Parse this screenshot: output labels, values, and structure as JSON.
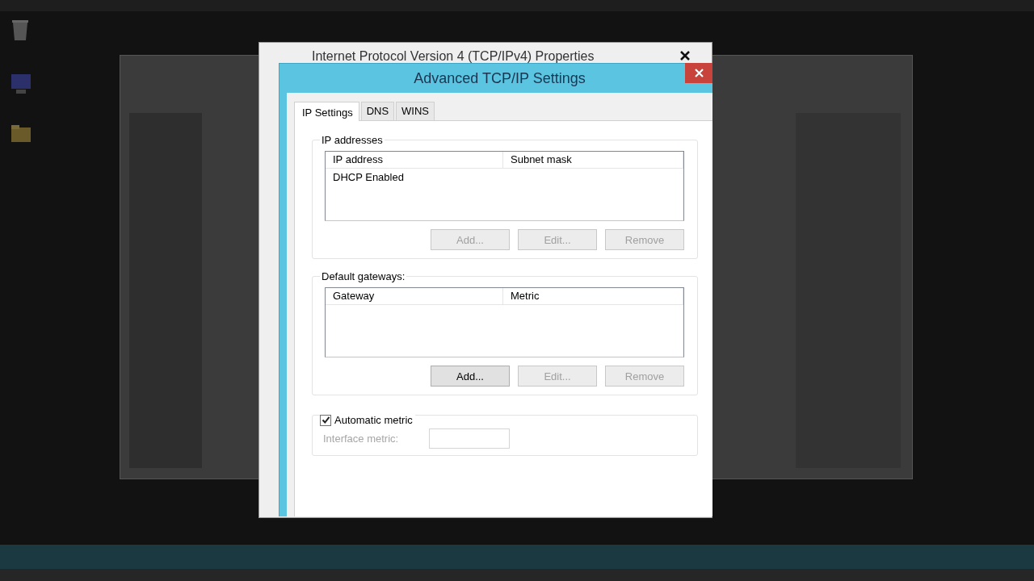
{
  "background_dialog": {
    "title": "Internet Protocol Version 4 (TCP/IPv4) Properties"
  },
  "dialog": {
    "title": "Advanced TCP/IP Settings"
  },
  "tabs": [
    {
      "label": "IP Settings",
      "selected": true
    },
    {
      "label": "DNS",
      "selected": false
    },
    {
      "label": "WINS",
      "selected": false
    }
  ],
  "ip_addresses": {
    "label": "IP addresses",
    "columns": [
      "IP address",
      "Subnet mask"
    ],
    "rows": [
      {
        "cells": [
          "DHCP Enabled"
        ]
      }
    ],
    "buttons": [
      {
        "label": "Add...",
        "disabled": true
      },
      {
        "label": "Edit...",
        "disabled": true
      },
      {
        "label": "Remove",
        "disabled": true
      }
    ]
  },
  "default_gateways": {
    "label": "Default gateways:",
    "columns": [
      "Gateway",
      "Metric"
    ],
    "buttons": [
      {
        "label": "Add...",
        "disabled": false
      },
      {
        "label": "Edit...",
        "disabled": true
      },
      {
        "label": "Remove",
        "disabled": true
      }
    ]
  },
  "metric": {
    "automatic": {
      "label": "Automatic metric",
      "checked": true
    },
    "interface_metric": {
      "label": "Interface metric:",
      "disabled": true
    }
  }
}
